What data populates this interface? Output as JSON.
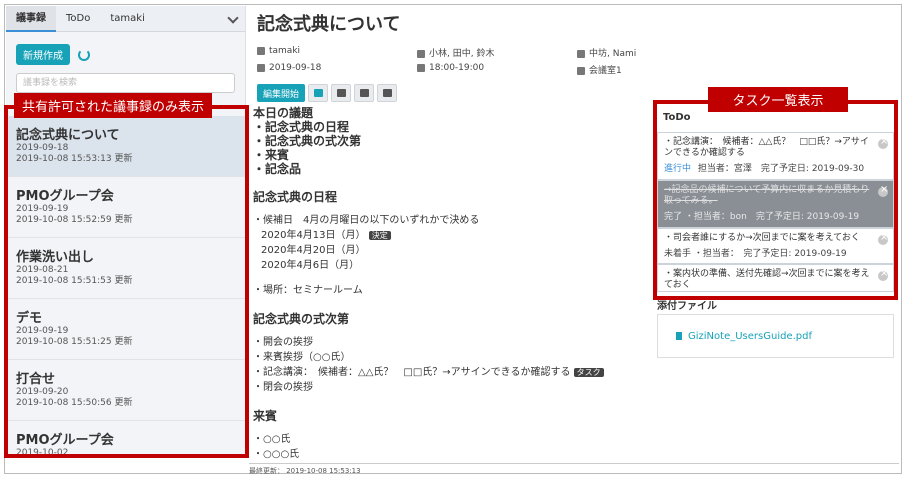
{
  "sidebar": {
    "tabs": [
      "議事録",
      "ToDo",
      "tamaki"
    ],
    "new_button": "新規作成",
    "search_placeholder": "議事録を検索",
    "items": [
      {
        "title": "記念式典について",
        "date": "2019-09-18",
        "updated": "2019-10-08 15:53:13 更新"
      },
      {
        "title": "PMOグループ会",
        "date": "2019-09-19",
        "updated": "2019-10-08 15:52:59 更新"
      },
      {
        "title": "作業洗い出し",
        "date": "2019-08-21",
        "updated": "2019-10-08 15:51:53 更新"
      },
      {
        "title": "デモ",
        "date": "2019-09-19",
        "updated": "2019-10-08 15:51:25 更新"
      },
      {
        "title": "打合せ",
        "date": "2019-09-20",
        "updated": "2019-10-08 15:50:56 更新"
      },
      {
        "title": "PMOグループ会",
        "date": "2019-10-02",
        "updated": ""
      }
    ]
  },
  "annotations": {
    "left": "共有許可された議事録のみ表示",
    "right": "タスク一覧表示"
  },
  "main": {
    "title": "記念式典について",
    "meta": {
      "author": "tamaki",
      "attendees": "小林, 田中, 鈴木",
      "shared": "中坊, Nami",
      "date": "2019-09-18",
      "time": "18:00-19:00",
      "room": "会議室1"
    },
    "start_button": "編集開始",
    "agenda_title": "本日の議題",
    "agenda": [
      "・記念式典の日程",
      "・記念式典の式次第",
      "・来賓",
      "・記念品"
    ],
    "sections": {
      "schedule_title": "記念式典の日程",
      "schedule_lines": [
        "・候補日　4月の月曜日の以下のいずれかで決める",
        "2020年4月13日（月）",
        "2020年4月20日（月）",
        "2020年4月6日（月）"
      ],
      "decided_tag": "決定",
      "place": "・場所：セミナールーム",
      "order_title": "記念式典の式次第",
      "order_lines": [
        "・開会の挨拶",
        "・来賓挨拶（○○氏）",
        "・記念講演：　候補者：△△氏？　□□氏？→アサインできるか確認する",
        "・閉会の挨拶"
      ],
      "task_tag": "タスク",
      "guest_title": "来賓",
      "guest_lines": [
        "・○○氏",
        "・○○○氏"
      ]
    }
  },
  "todo": {
    "header": "ToDo",
    "items": [
      {
        "text": "・記念講演：　候補者：△△氏？　□□氏？→アサインできるか確認する",
        "status": "進行中",
        "owner": "担当者：宮澤",
        "due": "完了予定日: 2019-09-30"
      },
      {
        "text": "→記念品の候補について予算内に収まるか見積もり取ってみる。",
        "status": "完了",
        "owner": "担当者：bon",
        "due": "完了予定日: 2019-09-19"
      },
      {
        "text": "・司会者誰にするか→次回までに案を考えておく",
        "status": "未着手",
        "owner": "担当者：",
        "due": "完了予定日: 2019-09-19"
      },
      {
        "text": "・案内状の準備、送付先確認→次回までに案を考えておく",
        "status": "",
        "owner": "",
        "due": ""
      }
    ]
  },
  "files": {
    "header": "添付ファイル",
    "file": "GiziNote_UsersGuide.pdf"
  },
  "footer": "最終更新： 2019-10-08 15:53:13"
}
